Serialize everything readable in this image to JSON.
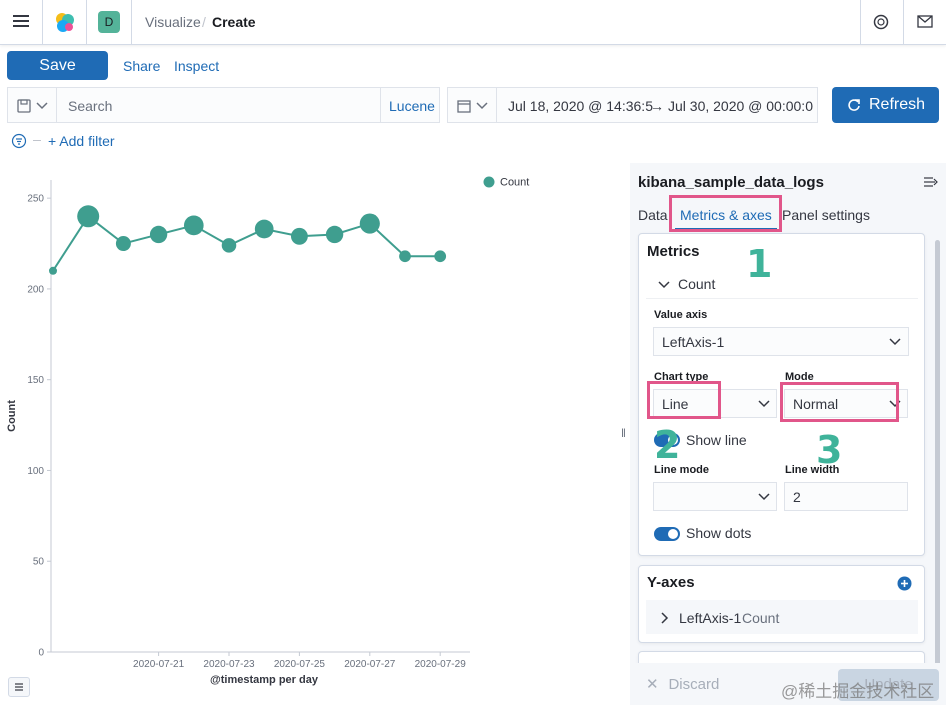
{
  "header": {
    "space_letter": "D",
    "breadcrumb_parent": "Visualize",
    "breadcrumb_sep": "/",
    "breadcrumb_current": "Create"
  },
  "toolbar": {
    "save_label": "Save",
    "share_label": "Share",
    "inspect_label": "Inspect"
  },
  "query": {
    "search_placeholder": "Search",
    "language": "Lucene",
    "date_start": "Jul 18, 2020 @ 14:36:5",
    "date_arrow": "→",
    "date_end": "Jul 30, 2020 @ 00:00:0",
    "refresh_label": "Refresh",
    "add_filter_label": "+ Add filter"
  },
  "chart_data": {
    "type": "line",
    "series": [
      {
        "name": "Count",
        "color": "#3f9e8f",
        "x": [
          "2020-07-18",
          "2020-07-19",
          "2020-07-20",
          "2020-07-21",
          "2020-07-22",
          "2020-07-23",
          "2020-07-24",
          "2020-07-25",
          "2020-07-26",
          "2020-07-27",
          "2020-07-28",
          "2020-07-29"
        ],
        "values": [
          210,
          240,
          225,
          230,
          235,
          224,
          233,
          229,
          230,
          236,
          218,
          218
        ]
      }
    ],
    "ylabel": "Count",
    "xlabel": "@timestamp per day",
    "y_ticks": [
      0,
      50,
      100,
      150,
      200,
      250
    ],
    "x_tick_labels": [
      "2020-07-21",
      "2020-07-23",
      "2020-07-25",
      "2020-07-27",
      "2020-07-29"
    ],
    "ylim": [
      0,
      260
    ],
    "legend": "top-right",
    "grid": false
  },
  "sidebar": {
    "index_title": "kibana_sample_data_logs",
    "tabs": [
      "Data",
      "Metrics & axes",
      "Panel settings"
    ],
    "metrics_title": "Metrics",
    "metric_name": "Count",
    "value_axis_label": "Value axis",
    "value_axis_value": "LeftAxis-1",
    "chart_type_label": "Chart type",
    "chart_type_value": "Line",
    "mode_label": "Mode",
    "mode_value": "Normal",
    "show_line_label": "Show line",
    "line_mode_label": "Line mode",
    "line_width_label": "Line width",
    "line_width_value": "2",
    "show_dots_label": "Show dots",
    "y_axes_title": "Y-axes",
    "y_axis_item": "LeftAxis-1",
    "y_axis_item_metric": "Count",
    "discard_label": "Discard",
    "update_label": "Update"
  },
  "annotations": {
    "n1": "1",
    "n2": "2",
    "n3": "3"
  },
  "watermark": "@稀土掘金技术社区"
}
